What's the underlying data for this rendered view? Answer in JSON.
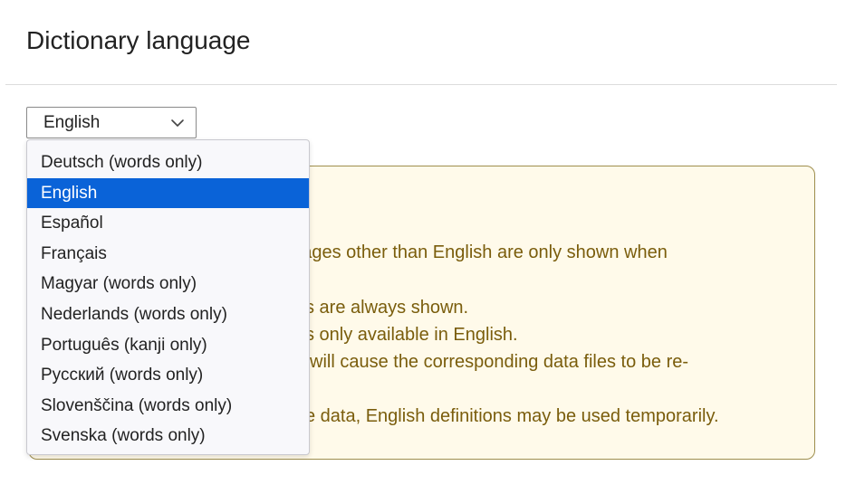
{
  "section": {
    "title": "Dictionary language"
  },
  "select": {
    "value": "English",
    "icon": "chevron-down-icon"
  },
  "dropdown": {
    "selected_index": 1,
    "options": [
      "Deutsch (words only)",
      "English",
      "Español",
      "Français",
      "Magyar (words only)",
      "Nederlands (words only)",
      "Português (kanji only)",
      "Русский (words only)",
      "Slovenščina (words only)",
      "Svenska (words only)"
    ]
  },
  "info": {
    "lines": [
      "guages other than English are only shown when",
      "s are always shown.",
      "s only available in English.",
      " will cause the corresponding data files to be re-",
      "e data, English definitions may be used temporarily."
    ]
  },
  "colors": {
    "selected_option_bg": "#0a63d8",
    "info_bg": "#fffaea",
    "info_text": "#7a5d0c",
    "info_border": "#9e8e4d"
  }
}
